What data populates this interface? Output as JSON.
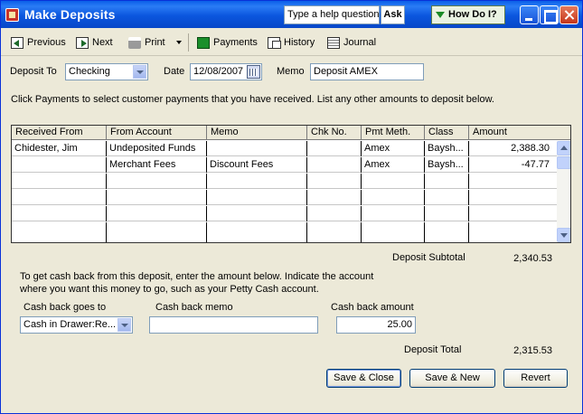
{
  "window": {
    "title": "Make Deposits",
    "help_placeholder": "Type a help question",
    "ask_label": "Ask",
    "how_do_i_label": "How Do I?"
  },
  "toolbar": {
    "previous": "Previous",
    "next": "Next",
    "print": "Print",
    "payments": "Payments",
    "history": "History",
    "journal": "Journal"
  },
  "header": {
    "deposit_to_label": "Deposit To",
    "deposit_to_value": "Checking",
    "date_label": "Date",
    "date_value": "12/08/2007",
    "memo_label": "Memo",
    "memo_value": "Deposit AMEX"
  },
  "instructions": "Click Payments to select customer payments that you have received. List any other amounts to deposit below.",
  "table": {
    "columns": [
      "Received From",
      "From Account",
      "Memo",
      "Chk No.",
      "Pmt Meth.",
      "Class",
      "Amount"
    ],
    "rows": [
      [
        "Chidester, Jim",
        "Undeposited Funds",
        "",
        "",
        "Amex",
        "Baysh...",
        "2,388.30"
      ],
      [
        "",
        "Merchant Fees",
        "Discount Fees",
        "",
        "Amex",
        "Baysh...",
        "-47.77"
      ],
      [
        "",
        "",
        "",
        "",
        "",
        "",
        ""
      ],
      [
        "",
        "",
        "",
        "",
        "",
        "",
        ""
      ],
      [
        "",
        "",
        "",
        "",
        "",
        "",
        ""
      ],
      [
        "",
        "",
        "",
        "",
        "",
        "",
        ""
      ]
    ]
  },
  "subtotal": {
    "label": "Deposit Subtotal",
    "value": "2,340.53"
  },
  "cashback": {
    "instructions_line1": "To get cash back from this deposit, enter the amount below.  Indicate the account",
    "instructions_line2": "where you want this money to go, such as your Petty Cash account.",
    "goes_to_label": "Cash back goes to",
    "goes_to_value": "Cash in Drawer:Re...",
    "memo_label": "Cash back memo",
    "memo_value": "",
    "amount_label": "Cash back amount",
    "amount_value": "25.00"
  },
  "total": {
    "label": "Deposit Total",
    "value": "2,315.53"
  },
  "buttons": {
    "save_close": "Save & Close",
    "save_new": "Save & New",
    "revert": "Revert"
  }
}
